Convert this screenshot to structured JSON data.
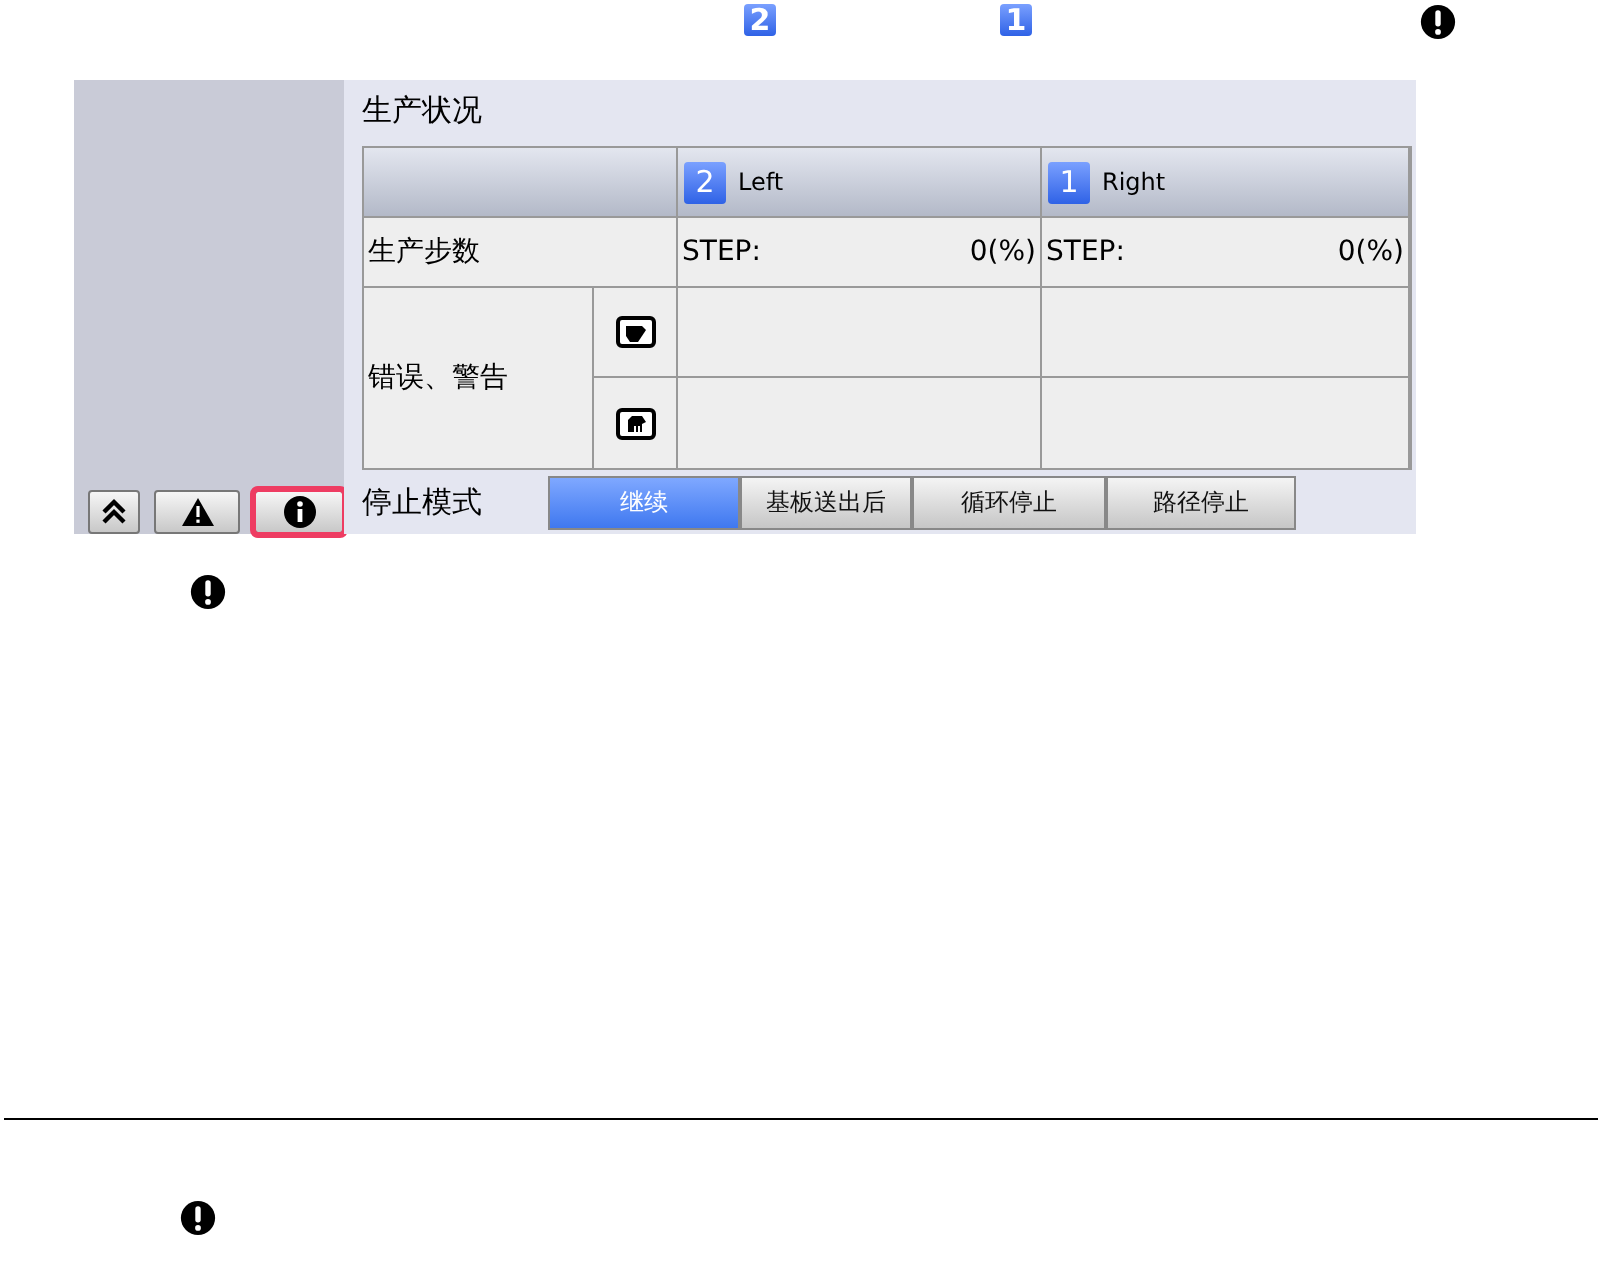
{
  "top_badges": [
    {
      "number": "2"
    },
    {
      "number": "1"
    }
  ],
  "sidebar_buttons": [
    {
      "kind": "collapse",
      "highlighted": false
    },
    {
      "kind": "warning",
      "highlighted": false
    },
    {
      "kind": "info",
      "highlighted": true
    }
  ],
  "panel": {
    "title": "生产状况",
    "columns": [
      {
        "badge": "2",
        "label": "Left"
      },
      {
        "badge": "1",
        "label": "Right"
      }
    ],
    "step_row": {
      "label": "生产步数",
      "cells": [
        {
          "prefix": "STEP:",
          "value": "0(%)"
        },
        {
          "prefix": "STEP:",
          "value": "0(%)"
        }
      ]
    },
    "error_rows": {
      "label": "错误、警告",
      "rows": [
        {
          "kind": "machine"
        },
        {
          "kind": "hand"
        }
      ]
    },
    "stop_mode": {
      "label": "停止模式",
      "buttons": [
        {
          "label": "继续",
          "selected": true
        },
        {
          "label": "基板送出后",
          "selected": false
        },
        {
          "label": "循环停止",
          "selected": false
        },
        {
          "label": "路径停止",
          "selected": false
        }
      ]
    }
  }
}
